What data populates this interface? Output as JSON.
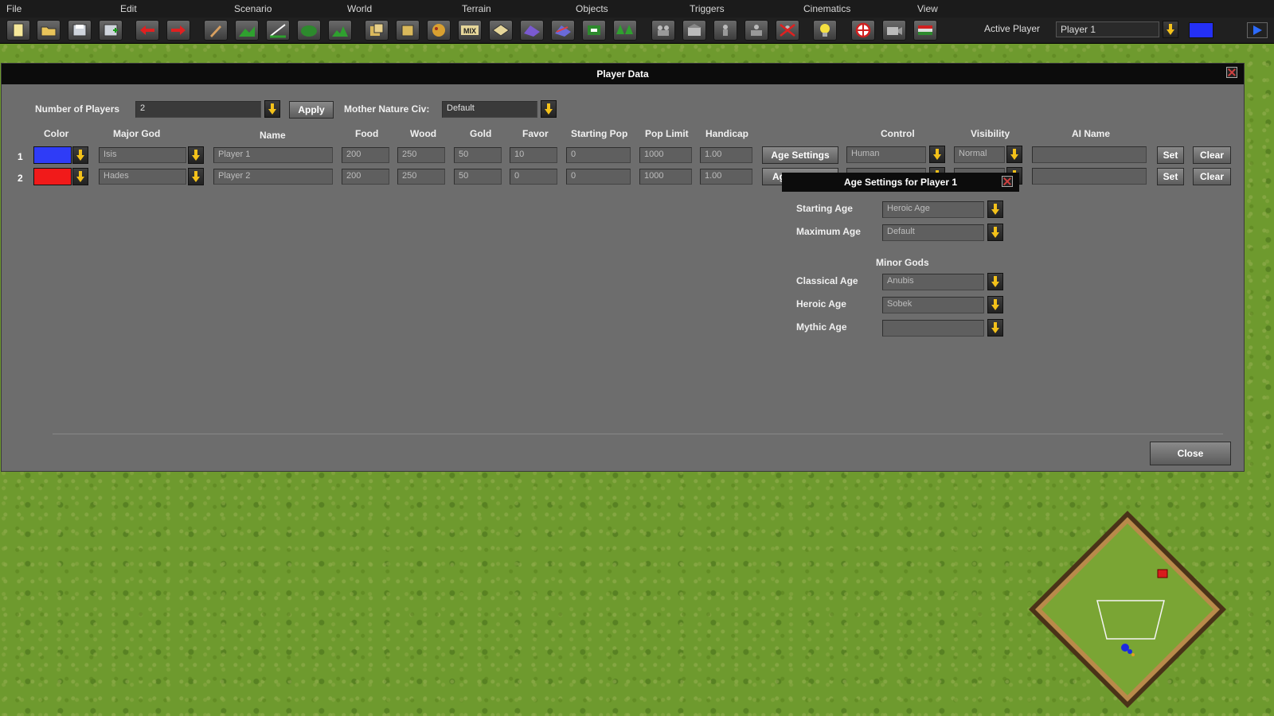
{
  "menu": [
    "File",
    "Edit",
    "Scenario",
    "World",
    "Terrain",
    "Objects",
    "Triggers",
    "Cinematics",
    "View"
  ],
  "toolbar": {
    "icons": [
      "new-file-icon",
      "open-folder-icon",
      "save-icon",
      "save-as-icon",
      "undo-arrow-icon",
      "redo-arrow-icon",
      "paint-brush-icon",
      "elevate-terrain-icon",
      "smooth-terrain-icon",
      "water-icon",
      "cliff-icon",
      "copy-icon",
      "paste-icon",
      "paint-terrain-icon",
      "mix-terrain-icon",
      "erase-terrain-icon",
      "road-icon",
      "river-icon",
      "flag-icon",
      "forest-icon",
      "place-units-icon",
      "place-buildings-icon",
      "move-units-icon",
      "group-units-icon",
      "delete-units-icon",
      "light-bulb-icon",
      "target-icon",
      "camera-icon",
      "flag-banner-icon"
    ],
    "active_player_label": "Active Player",
    "active_player_value": "Player 1",
    "active_player_color": "#2430f5"
  },
  "player_dialog": {
    "title": "Player Data",
    "num_players_label": "Number of Players",
    "num_players_value": "2",
    "apply_label": "Apply",
    "mother_nature_label": "Mother Nature Civ:",
    "mother_nature_value": "Default",
    "columns": [
      "Color",
      "Major God",
      "Name",
      "Food",
      "Wood",
      "Gold",
      "Favor",
      "Starting Pop",
      "Pop Limit",
      "Handicap",
      "Control",
      "Visibility",
      "AI Name"
    ],
    "players": [
      {
        "num": "1",
        "color": "#2f3cf7",
        "god": "Isis",
        "name": "Player 1",
        "food": "200",
        "wood": "250",
        "gold": "50",
        "favor": "10",
        "starting_pop": "0",
        "pop_limit": "1000",
        "handicap": "1.00",
        "age_settings": "Age Settings",
        "control": "Human",
        "visibility": "Normal",
        "ai_name": "",
        "set": "Set",
        "clear": "Clear"
      },
      {
        "num": "2",
        "color": "#f11a1a",
        "god": "Hades",
        "name": "Player 2",
        "food": "200",
        "wood": "250",
        "gold": "50",
        "favor": "0",
        "starting_pop": "0",
        "pop_limit": "1000",
        "handicap": "1.00",
        "age_settings": "Ag",
        "control": "",
        "visibility": "",
        "ai_name": "",
        "set": "Set",
        "clear": "Clear"
      }
    ],
    "close_label": "Close"
  },
  "age_settings": {
    "title": "Age Settings for Player 1",
    "starting_age_label": "Starting Age",
    "starting_age_value": "Heroic Age",
    "maximum_age_label": "Maximum Age",
    "maximum_age_value": "Default",
    "minor_gods_label": "Minor Gods",
    "classical_label": "Classical Age",
    "classical_value": "Anubis",
    "heroic_label": "Heroic Age",
    "heroic_value": "Sobek",
    "mythic_label": "Mythic Age",
    "mythic_value": ""
  }
}
